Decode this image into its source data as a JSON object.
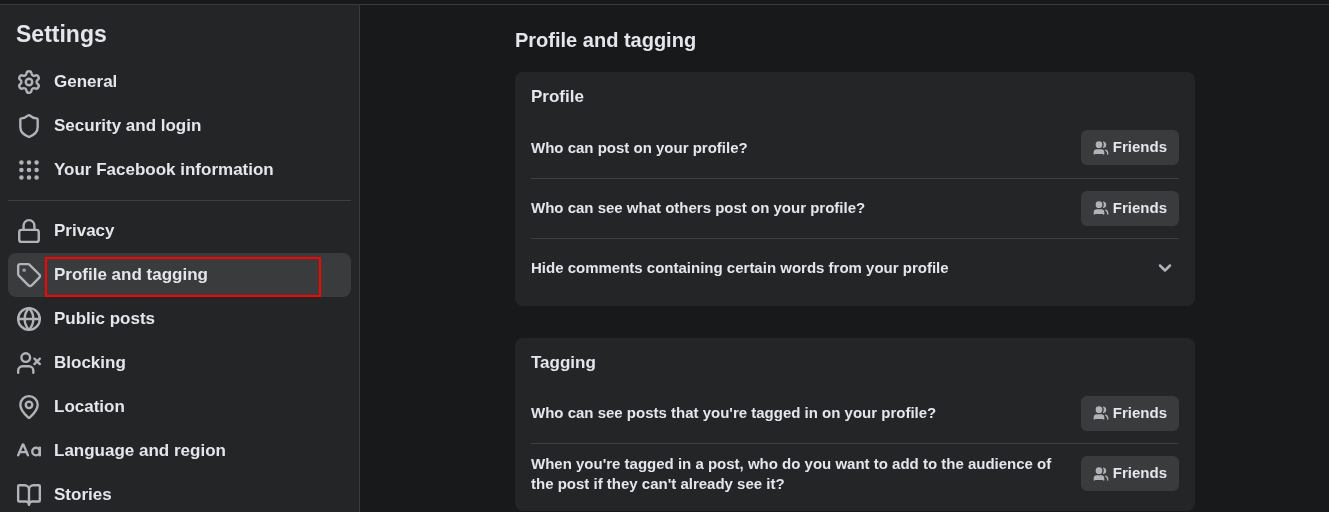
{
  "sidebar": {
    "title": "Settings",
    "groups": [
      {
        "items": [
          {
            "label": "General",
            "selected": false,
            "highlighted": false
          },
          {
            "label": "Security and login",
            "selected": false,
            "highlighted": false
          },
          {
            "label": "Your Facebook information",
            "selected": false,
            "highlighted": false
          }
        ]
      },
      {
        "items": [
          {
            "label": "Privacy",
            "selected": false,
            "highlighted": false
          },
          {
            "label": "Profile and tagging",
            "selected": true,
            "highlighted": true
          },
          {
            "label": "Public posts",
            "selected": false,
            "highlighted": false
          },
          {
            "label": "Blocking",
            "selected": false,
            "highlighted": false
          },
          {
            "label": "Location",
            "selected": false,
            "highlighted": false
          },
          {
            "label": "Language and region",
            "selected": false,
            "highlighted": false
          },
          {
            "label": "Stories",
            "selected": false,
            "highlighted": false
          }
        ]
      }
    ]
  },
  "page_title": "Profile and tagging",
  "sections": [
    {
      "title": "Profile",
      "rows": [
        {
          "kind": "audience",
          "label": "Who can post on your profile?",
          "value": "Friends"
        },
        {
          "kind": "audience",
          "label": "Who can see what others post on your profile?",
          "value": "Friends"
        },
        {
          "kind": "expand",
          "label": "Hide comments containing certain words from your profile",
          "expanded": false
        }
      ]
    },
    {
      "title": "Tagging",
      "rows": [
        {
          "kind": "audience",
          "label": "Who can see posts that you're tagged in on your profile?",
          "value": "Friends"
        },
        {
          "kind": "audience",
          "label": "When you're tagged in a post, who do you want to add to the audience of the post if they can't already see it?",
          "value": "Friends"
        }
      ]
    }
  ]
}
